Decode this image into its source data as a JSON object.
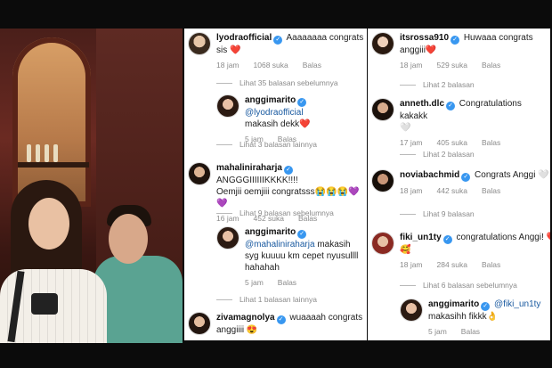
{
  "colors": {
    "verified": "#3897f0",
    "mention": "#1a5aa0",
    "meta": "#8a8a8a"
  },
  "col2": {
    "c1": {
      "user": "lyodraofficial",
      "text": "Aaaaaaaa congrats sis ❤️",
      "time": "18 jam",
      "likes": "1068 suka",
      "reply": "Balas"
    },
    "more1": "Lihat 35 balasan sebelumnya",
    "c2": {
      "user": "anggimarito",
      "mention": "@lyodraofficial",
      "text": "makasih dekk❤️",
      "time": "5 jam",
      "likes": "",
      "reply": "Balas"
    },
    "more2": "Lihat 3 balasan lainnya",
    "c3": {
      "user": "mahaliniraharja",
      "text": "ANGGGIIIIIIKKKK!!!!",
      "text2": "Oemjii oemjiii congratsss😭😭😭💜💜",
      "time": "16 jam",
      "likes": "452 suka",
      "reply": "Balas"
    },
    "more3": "Lihat 9 balasan sebelumnya",
    "c4": {
      "user": "anggimarito",
      "mention": "@mahaliniraharja",
      "text": "makasih",
      "text2": "syg kuuuu km cepet nyusullll",
      "text3": "hahahah",
      "time": "5 jam",
      "likes": "",
      "reply": "Balas"
    },
    "more4": "Lihat 1 balasan lainnya",
    "c5": {
      "user": "zivamagnolya",
      "text": "wuaaaah congrats",
      "text2": "anggiiii 😍",
      "time": "",
      "likes": "",
      "reply": ""
    }
  },
  "col3": {
    "c1": {
      "user": "itsrossa910",
      "text": "Huwaaa congrats",
      "text2": "anggiii❤️",
      "time": "18 jam",
      "likes": "529 suka",
      "reply": "Balas"
    },
    "more1": "Lihat 2 balasan",
    "c2": {
      "user": "anneth.dlc",
      "text": "Congratulations kakakk",
      "text2": "🤍",
      "time": "17 jam",
      "likes": "405 suka",
      "reply": "Balas"
    },
    "more2": "Lihat 2 balasan",
    "c3": {
      "user": "noviabachmid",
      "text": "Congrats Anggi 🤍",
      "time": "18 jam",
      "likes": "442 suka",
      "reply": "Balas"
    },
    "more3": "Lihat 9 balasan",
    "c4": {
      "user": "fiki_un1ty",
      "text": "congratulations Anggi! ❤️",
      "text2": "🥰",
      "time": "18 jam",
      "likes": "284 suka",
      "reply": "Balas"
    },
    "more4": "Lihat 6 balasan sebelumnya",
    "c5": {
      "user": "anggimarito",
      "mention": "@fiki_un1ty",
      "text2": "makasihh fikkk👌",
      "time": "5 jam",
      "likes": "",
      "reply": "Balas"
    }
  }
}
